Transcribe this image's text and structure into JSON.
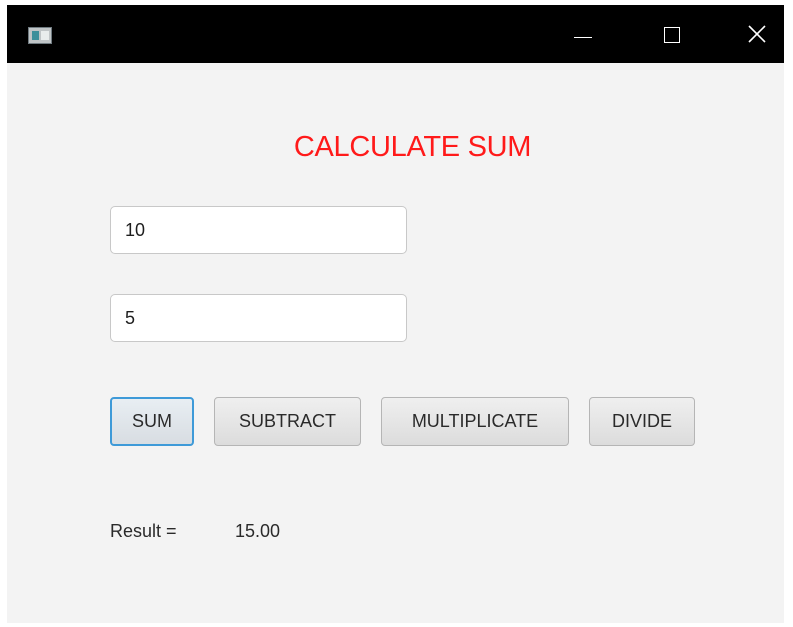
{
  "window": {
    "title": "",
    "controls": {
      "minimize_icon": "minimize-icon",
      "maximize_icon": "maximize-icon",
      "close_icon": "close-icon"
    }
  },
  "main": {
    "heading": "CALCULATE SUM",
    "heading_color": "#ff1a1a",
    "input_a": {
      "value": "10"
    },
    "input_b": {
      "value": "5"
    },
    "buttons": {
      "sum": "SUM",
      "subtract": "SUBTRACT",
      "multiplicate": "MULTIPLICATE",
      "divide": "DIVIDE"
    },
    "focus_color": "#3e9ad8",
    "result": {
      "label": "Result =",
      "value": "15.00"
    }
  }
}
